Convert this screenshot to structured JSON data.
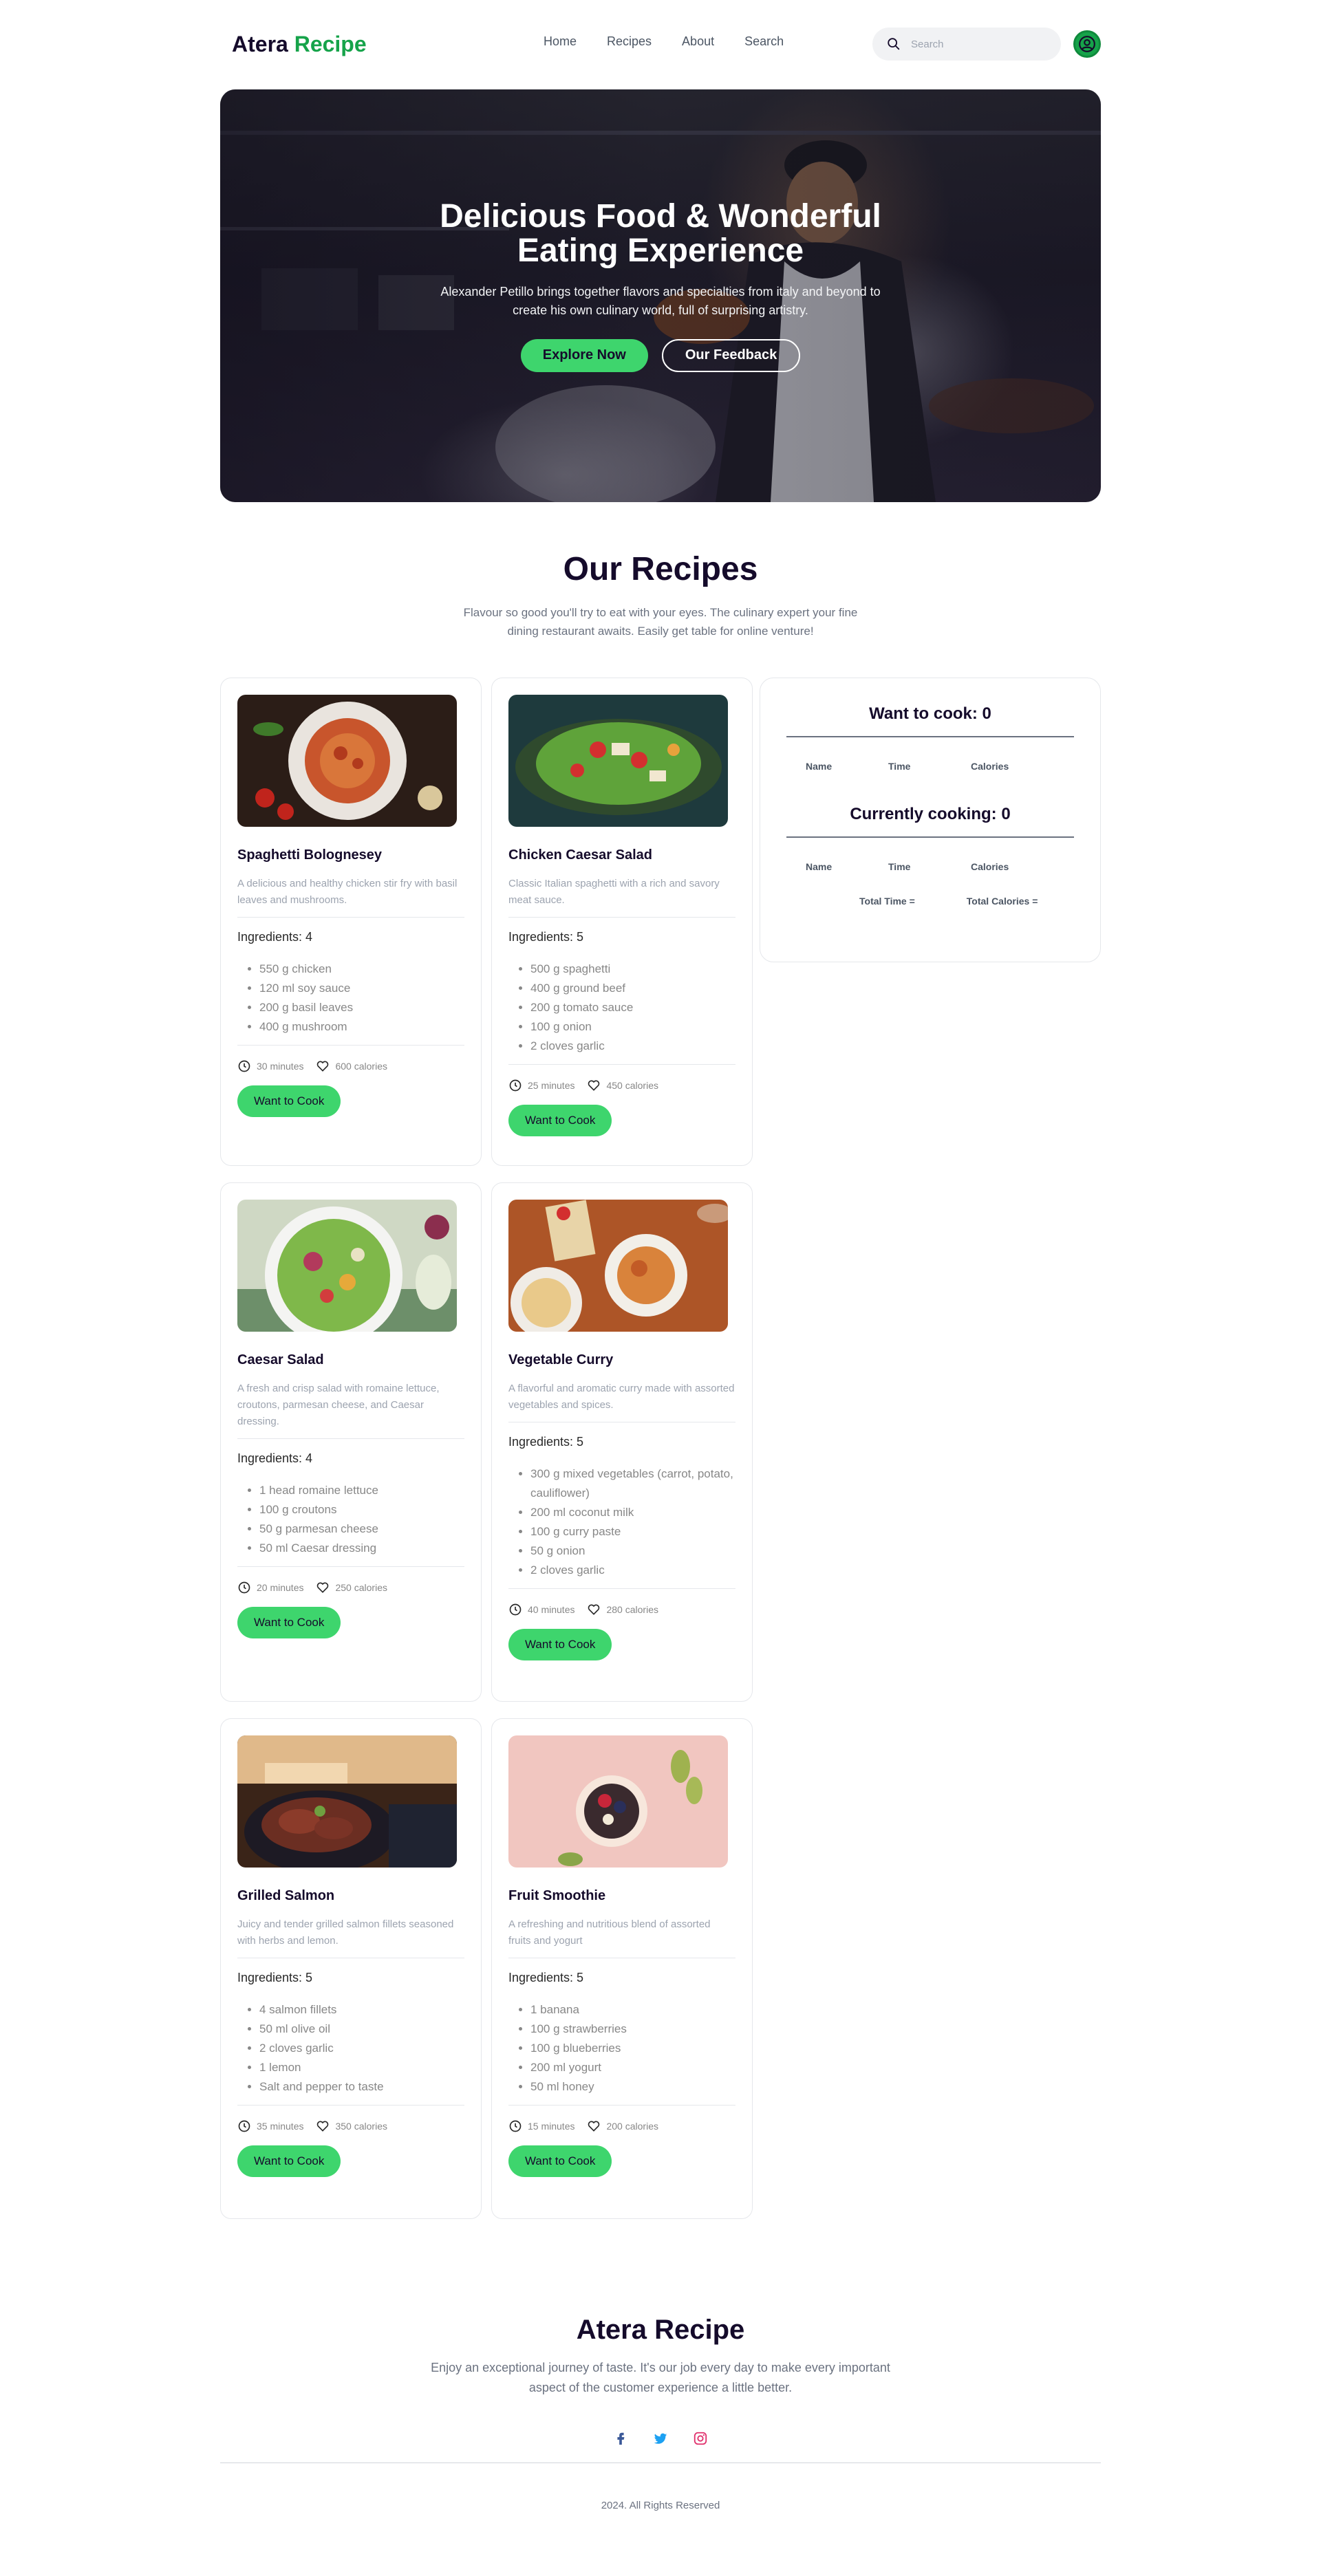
{
  "nav": {
    "logo_main": "Atera",
    "logo_accent": "Recipe",
    "links": [
      "Home",
      "Recipes",
      "About",
      "Search"
    ],
    "search_placeholder": "Search"
  },
  "hero": {
    "title": "Delicious Food & Wonderful Eating Experience",
    "subtitle": "Alexander Petillo brings together flavors and specialties from italy and beyond to create his own culinary world, full of surprising artistry.",
    "btn_primary": "Explore Now",
    "btn_secondary": "Our Feedback"
  },
  "recipes_section": {
    "title": "Our Recipes",
    "subtitle": "Flavour so good you'll try to eat with your eyes. The culinary expert your fine dining restaurant awaits. Easily get table for online venture!"
  },
  "recipes": [
    {
      "name": "Spaghetti Bolognesey",
      "description": "A delicious and healthy chicken stir fry with basil leaves and mushrooms.",
      "ingredients_label": "Ingredients: 4",
      "ingredients": [
        "550 g chicken",
        "120 ml soy sauce",
        "200 g basil leaves",
        "400 g mushroom"
      ],
      "time": "30 minutes",
      "calories": "600 calories",
      "button": "Want to Cook"
    },
    {
      "name": "Chicken Caesar Salad",
      "description": "Classic Italian spaghetti with a rich and savory meat sauce.",
      "ingredients_label": "Ingredients: 5",
      "ingredients": [
        "500 g spaghetti",
        "400 g ground beef",
        "200 g tomato sauce",
        "100 g onion",
        "2 cloves garlic"
      ],
      "time": "25 minutes",
      "calories": "450 calories",
      "button": "Want to Cook"
    },
    {
      "name": "Caesar Salad",
      "description": "A fresh and crisp salad with romaine lettuce, croutons, parmesan cheese, and Caesar dressing.",
      "ingredients_label": "Ingredients: 4",
      "ingredients": [
        "1 head romaine lettuce",
        "100 g croutons",
        "50 g parmesan cheese",
        "50 ml Caesar dressing"
      ],
      "time": "20 minutes",
      "calories": "250 calories",
      "button": "Want to Cook"
    },
    {
      "name": "Vegetable Curry",
      "description": "A flavorful and aromatic curry made with assorted vegetables and spices.",
      "ingredients_label": "Ingredients: 5",
      "ingredients": [
        "300 g mixed vegetables (carrot, potato, cauliflower)",
        "200 ml coconut milk",
        "100 g curry paste",
        "50 g onion",
        "2 cloves garlic"
      ],
      "time": "40 minutes",
      "calories": "280 calories",
      "button": "Want to Cook"
    },
    {
      "name": "Grilled Salmon",
      "description": "Juicy and tender grilled salmon fillets seasoned with herbs and lemon.",
      "ingredients_label": "Ingredients: 5",
      "ingredients": [
        "4 salmon fillets",
        "50 ml olive oil",
        "2 cloves garlic",
        "1 lemon",
        "Salt and pepper to taste"
      ],
      "time": "35 minutes",
      "calories": "350 calories",
      "button": "Want to Cook"
    },
    {
      "name": "Fruit Smoothie",
      "description": "A refreshing and nutritious blend of assorted fruits and yogurt",
      "ingredients_label": "Ingredients: 5",
      "ingredients": [
        "1 banana",
        "100 g strawberries",
        "100 g blueberries",
        "200 ml yogurt",
        "50 ml honey"
      ],
      "time": "15 minutes",
      "calories": "200 calories",
      "button": "Want to Cook"
    }
  ],
  "sidebar": {
    "want_title": "Want to cook: 0",
    "cooking_title": "Currently cooking: 0",
    "col_name": "Name",
    "col_time": "Time",
    "col_calories": "Calories",
    "total_time": "Total Time =",
    "total_calories": "Total Calories ="
  },
  "footer": {
    "title": "Atera Recipe",
    "text": "Enjoy an exceptional journey of taste. It's our job every day to make every important aspect of the customer experience a little better.",
    "copyright": "2024. All Rights Reserved"
  },
  "colors": {
    "accent": "#3ed56d",
    "brand_green": "#16a34a",
    "heading": "#150b2b"
  }
}
